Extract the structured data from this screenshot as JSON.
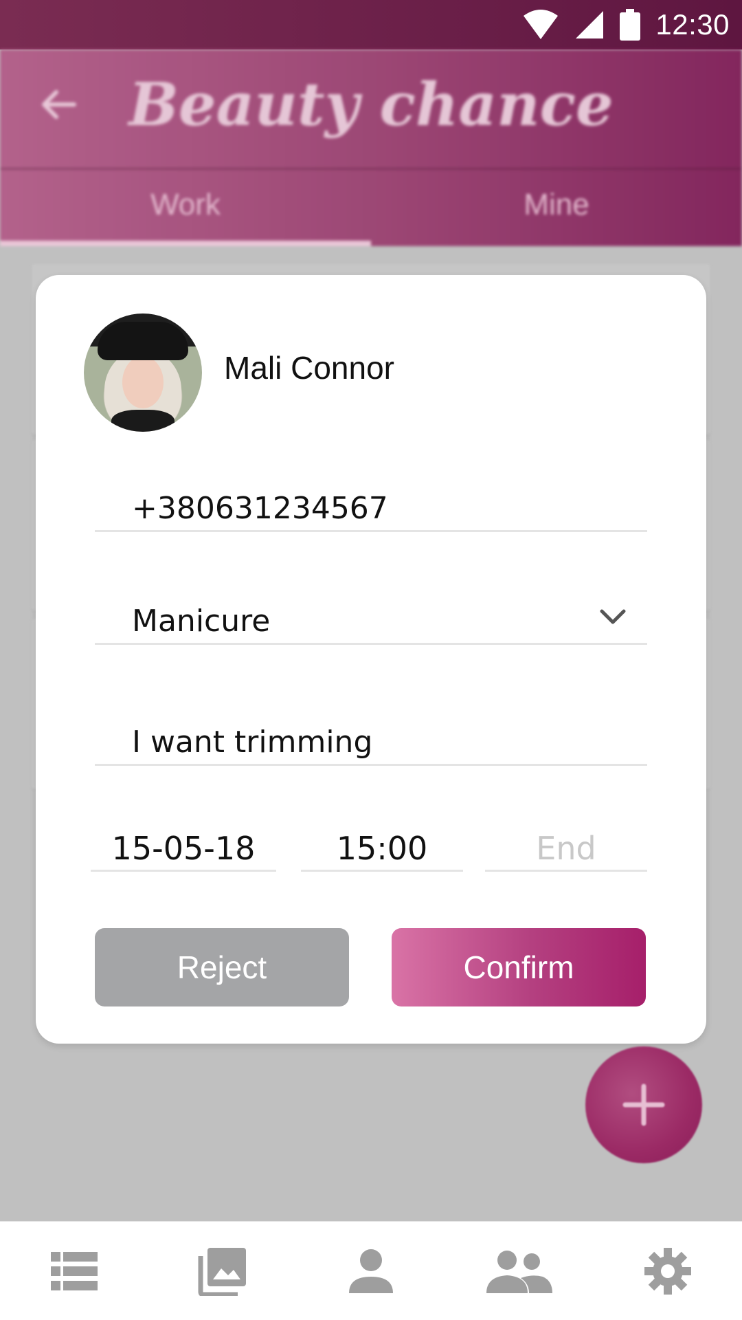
{
  "status": {
    "time": "12:30"
  },
  "header": {
    "title": "Beauty chance",
    "tabs": [
      {
        "label": "Work",
        "active": true
      },
      {
        "label": "Mine",
        "active": false
      }
    ]
  },
  "dialog": {
    "name": "Mali Connor",
    "phone": "+380631234567",
    "service": "Manicure",
    "comment": "I want trimming",
    "date": "15-05-18",
    "start_time": "15:00",
    "end_placeholder": "End",
    "reject_label": "Reject",
    "confirm_label": "Confirm"
  },
  "colors": {
    "accent": "#a61f6a",
    "accent_light": "#d973a6",
    "reject": "#a4a5a7",
    "nav_icon": "#9e9e9e"
  },
  "icons": {
    "back": "arrow-back-icon",
    "fab": "plus-icon",
    "service_dropdown": "chevron-down-icon",
    "nav": [
      "list-icon",
      "photos-icon",
      "person-icon",
      "people-icon",
      "settings-icon"
    ]
  }
}
